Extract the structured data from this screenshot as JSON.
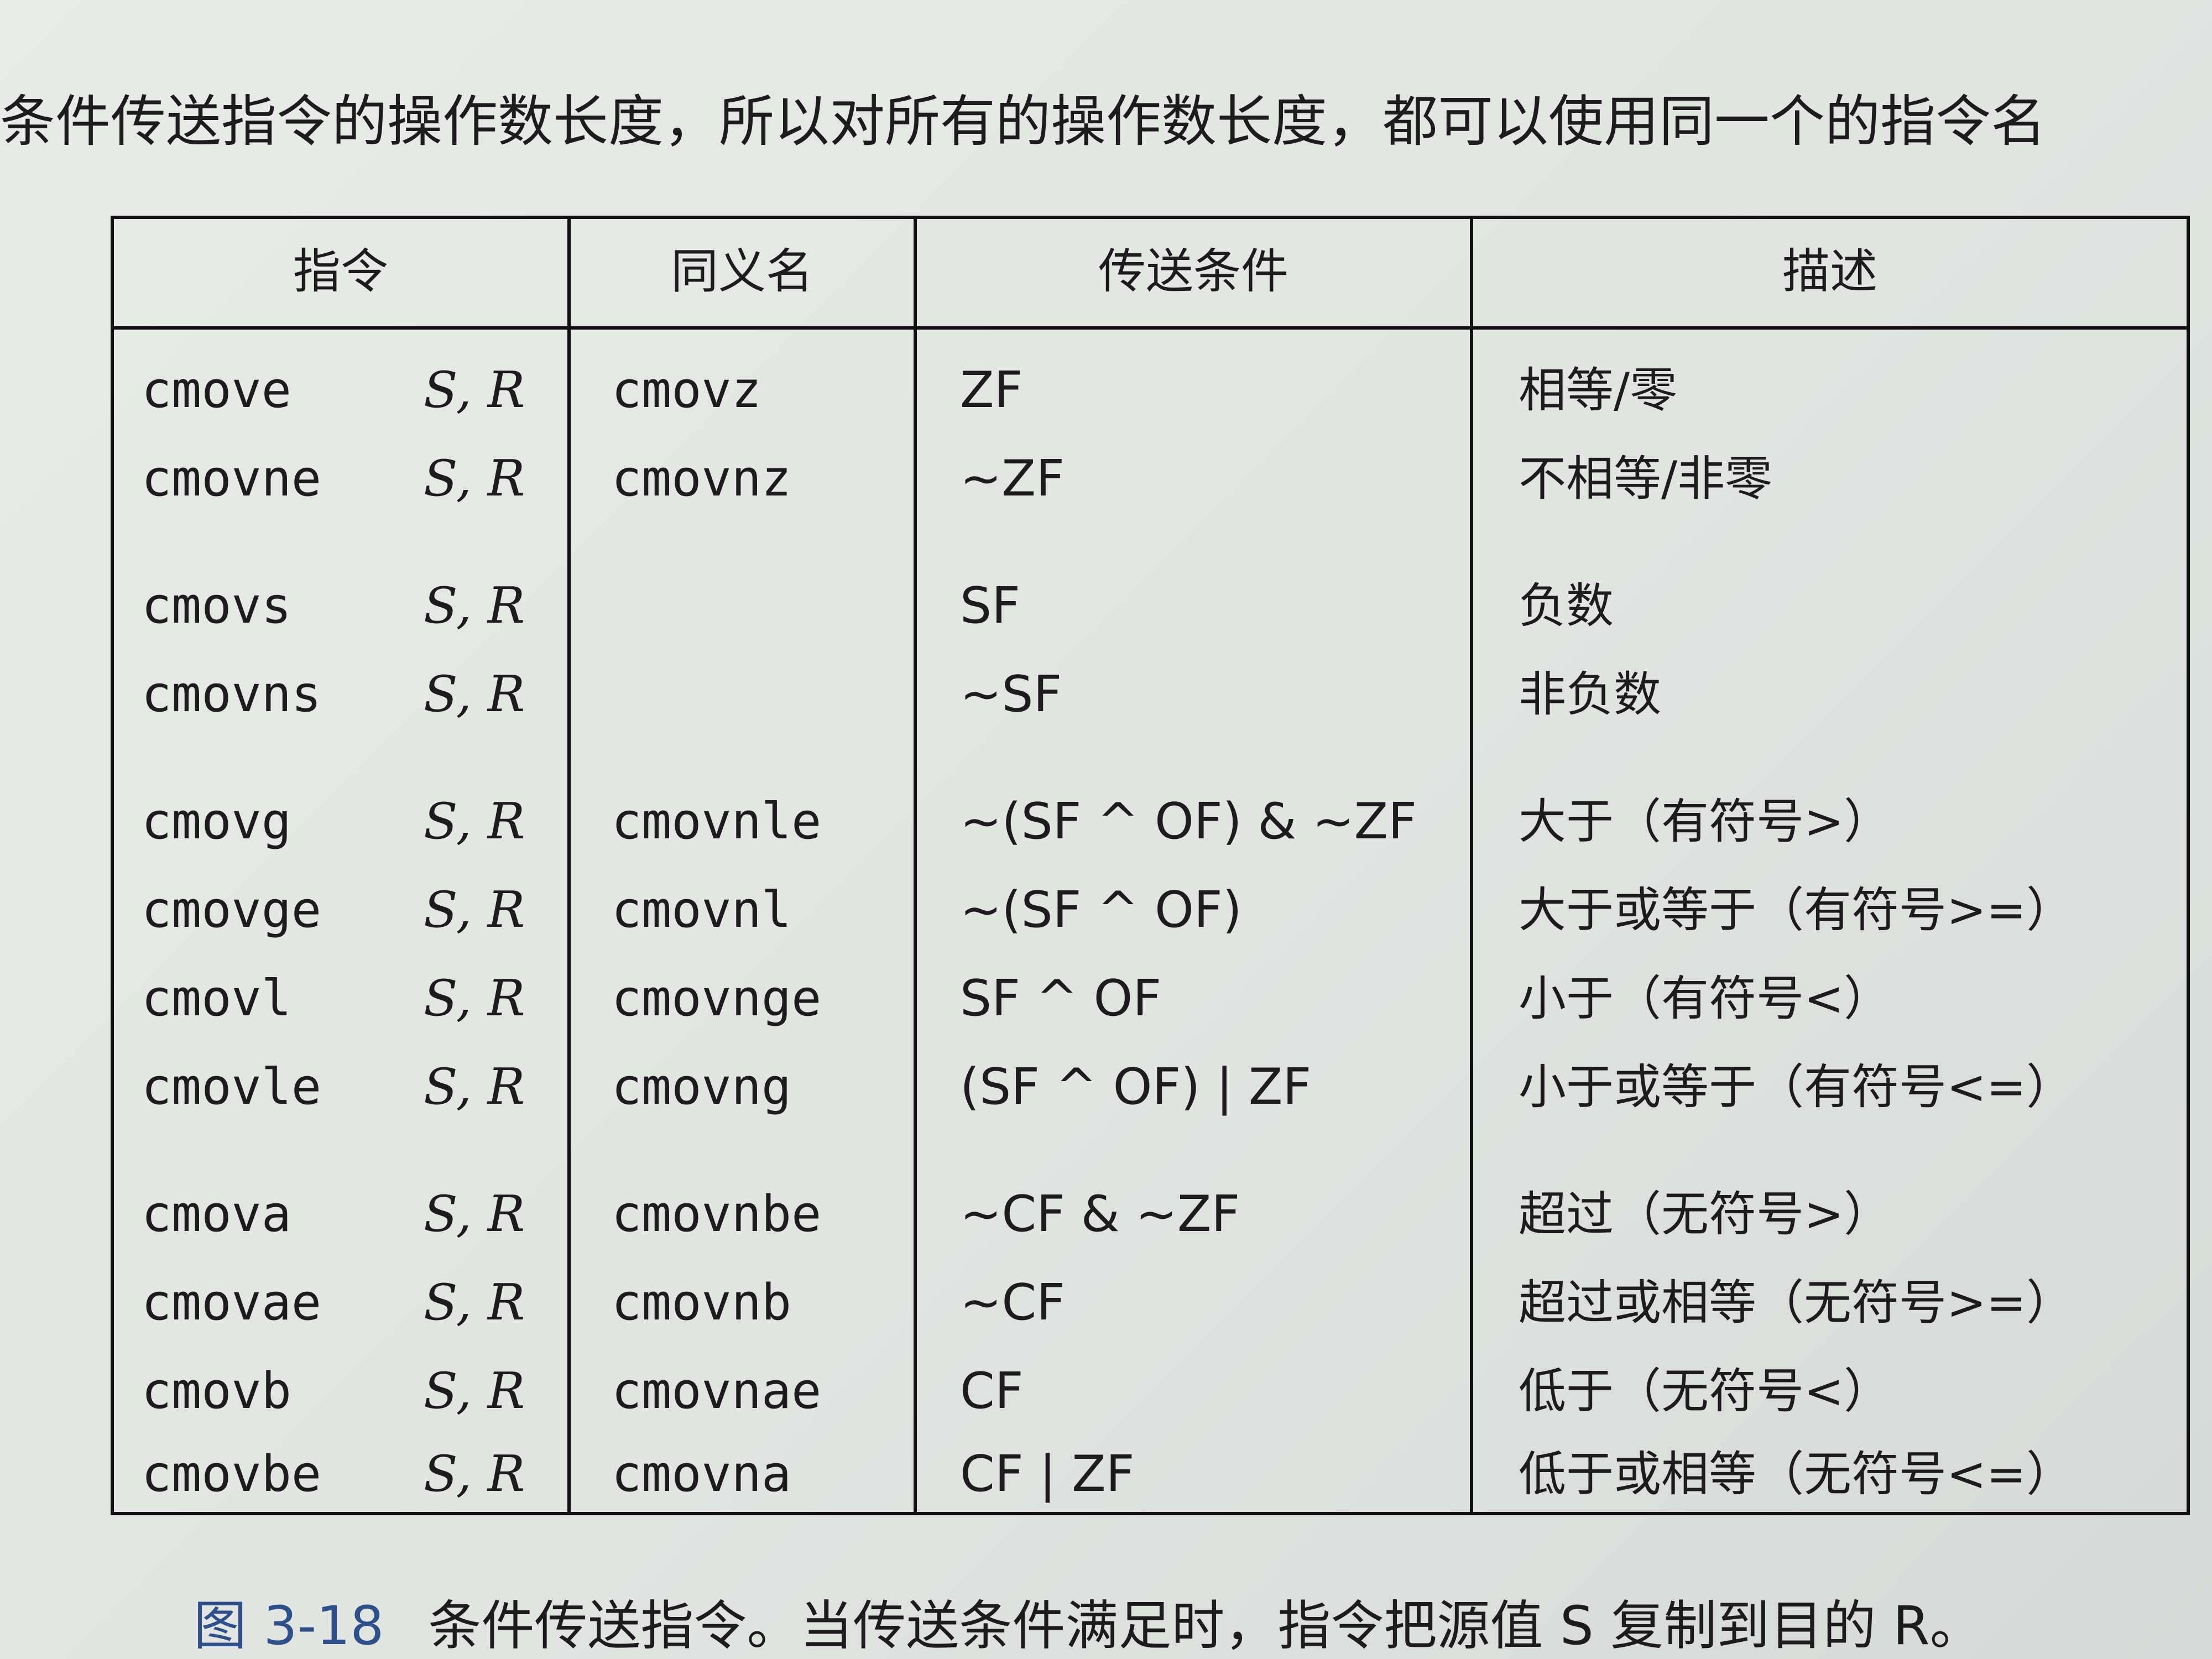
{
  "intro_text": "条件传送指令的操作数长度，所以对所有的操作数长度，都可以使用同一个的指令名",
  "table": {
    "headers": [
      "指令",
      "同义名",
      "传送条件",
      "描述"
    ],
    "rows": [
      {
        "instr": "cmove",
        "ops": "S, R",
        "synonym": "cmovz",
        "cond": "ZF",
        "desc": "相等/零"
      },
      {
        "instr": "cmovne",
        "ops": "S, R",
        "synonym": "cmovnz",
        "cond": "~ZF",
        "desc": "不相等/非零"
      },
      {
        "instr": "cmovs",
        "ops": "S, R",
        "synonym": "",
        "cond": "SF",
        "desc": "负数"
      },
      {
        "instr": "cmovns",
        "ops": "S, R",
        "synonym": "",
        "cond": "~SF",
        "desc": "非负数"
      },
      {
        "instr": "cmovg",
        "ops": "S, R",
        "synonym": "cmovnle",
        "cond": "~(SF ^ OF) & ~ZF",
        "desc": "大于（有符号>）"
      },
      {
        "instr": "cmovge",
        "ops": "S, R",
        "synonym": "cmovnl",
        "cond": "~(SF ^ OF)",
        "desc": "大于或等于（有符号>=）"
      },
      {
        "instr": "cmovl",
        "ops": "S, R",
        "synonym": "cmovnge",
        "cond": "SF ^ OF",
        "desc": "小于（有符号<）"
      },
      {
        "instr": "cmovle",
        "ops": "S, R",
        "synonym": "cmovng",
        "cond": "(SF ^ OF) | ZF",
        "desc": "小于或等于（有符号<=）"
      },
      {
        "instr": "cmova",
        "ops": "S, R",
        "synonym": "cmovnbe",
        "cond": "~CF & ~ZF",
        "desc": "超过（无符号>）"
      },
      {
        "instr": "cmovae",
        "ops": "S, R",
        "synonym": "cmovnb",
        "cond": "~CF",
        "desc": "超过或相等（无符号>=）"
      },
      {
        "instr": "cmovb",
        "ops": "S, R",
        "synonym": "cmovnae",
        "cond": "CF",
        "desc": "低于（无符号<）"
      },
      {
        "instr": "cmovbe",
        "ops": "S, R",
        "synonym": "cmovna",
        "cond": "CF | ZF",
        "desc": "低于或相等（无符号<=）"
      }
    ]
  },
  "caption": {
    "figure_label": "图 3-18",
    "text": "条件传送指令。当传送条件满足时，指令把源值 S 复制到目的 R。"
  }
}
